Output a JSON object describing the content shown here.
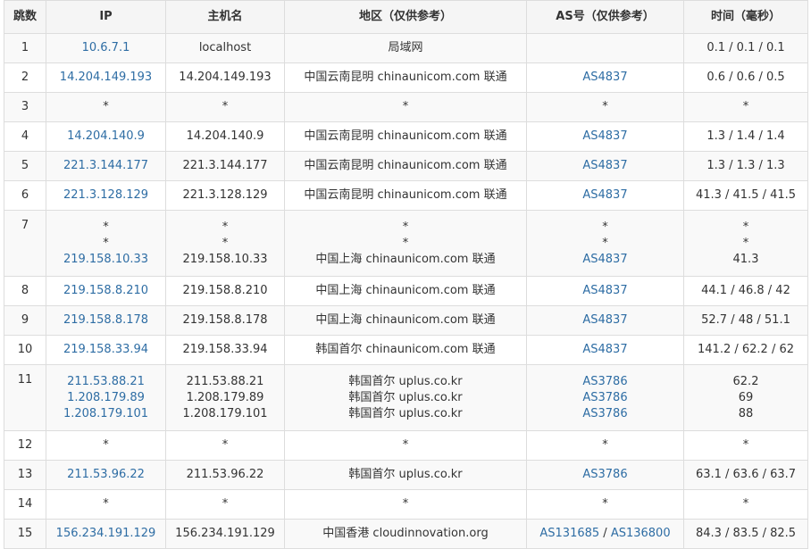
{
  "headers": {
    "hop": "跳数",
    "ip": "IP",
    "hostname": "主机名",
    "region": "地区（仅供参考）",
    "asn": "AS号（仅供参考）",
    "time": "时间（毫秒）"
  },
  "rows": [
    {
      "hop": "1",
      "lines": [
        {
          "ip": "10.6.7.1",
          "host": "localhost",
          "region": "局域网",
          "as": "",
          "time": "0.1 / 0.1 / 0.1"
        }
      ]
    },
    {
      "hop": "2",
      "lines": [
        {
          "ip": "14.204.149.193",
          "host": "14.204.149.193",
          "region": "中国云南昆明 chinaunicom.com 联通",
          "as": "AS4837",
          "time": "0.6 / 0.6 / 0.5"
        }
      ]
    },
    {
      "hop": "3",
      "lines": [
        {
          "ip": "*",
          "host": "*",
          "region": "*",
          "as": "*",
          "time": "*"
        }
      ]
    },
    {
      "hop": "4",
      "lines": [
        {
          "ip": "14.204.140.9",
          "host": "14.204.140.9",
          "region": "中国云南昆明 chinaunicom.com 联通",
          "as": "AS4837",
          "time": "1.3 / 1.4 / 1.4"
        }
      ]
    },
    {
      "hop": "5",
      "lines": [
        {
          "ip": "221.3.144.177",
          "host": "221.3.144.177",
          "region": "中国云南昆明 chinaunicom.com 联通",
          "as": "AS4837",
          "time": "1.3 / 1.3 / 1.3"
        }
      ]
    },
    {
      "hop": "6",
      "lines": [
        {
          "ip": "221.3.128.129",
          "host": "221.3.128.129",
          "region": "中国云南昆明 chinaunicom.com 联通",
          "as": "AS4837",
          "time": "41.3 / 41.5 / 41.5"
        }
      ]
    },
    {
      "hop": "7",
      "lines": [
        {
          "ip": "*",
          "host": "*",
          "region": "*",
          "as": "*",
          "time": "*"
        },
        {
          "ip": "*",
          "host": "*",
          "region": "*",
          "as": "*",
          "time": "*"
        },
        {
          "ip": "219.158.10.33",
          "host": "219.158.10.33",
          "region": "中国上海 chinaunicom.com 联通",
          "as": "AS4837",
          "time": "41.3"
        }
      ]
    },
    {
      "hop": "8",
      "lines": [
        {
          "ip": "219.158.8.210",
          "host": "219.158.8.210",
          "region": "中国上海 chinaunicom.com 联通",
          "as": "AS4837",
          "time": "44.1 / 46.8 / 42"
        }
      ]
    },
    {
      "hop": "9",
      "lines": [
        {
          "ip": "219.158.8.178",
          "host": "219.158.8.178",
          "region": "中国上海 chinaunicom.com 联通",
          "as": "AS4837",
          "time": "52.7 / 48 / 51.1"
        }
      ]
    },
    {
      "hop": "10",
      "lines": [
        {
          "ip": "219.158.33.94",
          "host": "219.158.33.94",
          "region": "韩国首尔 chinaunicom.com 联通",
          "as": "AS4837",
          "time": "141.2 / 62.2 / 62"
        }
      ]
    },
    {
      "hop": "11",
      "lines": [
        {
          "ip": "211.53.88.21",
          "host": "211.53.88.21",
          "region": "韩国首尔 uplus.co.kr",
          "as": "AS3786",
          "time": "62.2"
        },
        {
          "ip": "1.208.179.89",
          "host": "1.208.179.89",
          "region": "韩国首尔 uplus.co.kr",
          "as": "AS3786",
          "time": "69"
        },
        {
          "ip": "1.208.179.101",
          "host": "1.208.179.101",
          "region": "韩国首尔 uplus.co.kr",
          "as": "AS3786",
          "time": "88"
        }
      ]
    },
    {
      "hop": "12",
      "lines": [
        {
          "ip": "*",
          "host": "*",
          "region": "*",
          "as": "*",
          "time": "*"
        }
      ]
    },
    {
      "hop": "13",
      "lines": [
        {
          "ip": "211.53.96.22",
          "host": "211.53.96.22",
          "region": "韩国首尔 uplus.co.kr",
          "as": "AS3786",
          "time": "63.1 / 63.6 / 63.7"
        }
      ]
    },
    {
      "hop": "14",
      "lines": [
        {
          "ip": "*",
          "host": "*",
          "region": "*",
          "as": "*",
          "time": "*"
        }
      ]
    },
    {
      "hop": "15",
      "lines": [
        {
          "ip": "156.234.191.129",
          "host": "156.234.191.129",
          "region": "中国香港 cloudinnovation.org",
          "as": [
            "AS131685",
            "AS136800"
          ],
          "time": "84.3 / 83.5 / 82.5"
        }
      ]
    }
  ],
  "colors": {
    "link": "#2e6da4",
    "text": "#333333",
    "border": "#dddddd",
    "header_bg": "#f5f5f5",
    "stripe_bg": "#f9f9f9"
  }
}
